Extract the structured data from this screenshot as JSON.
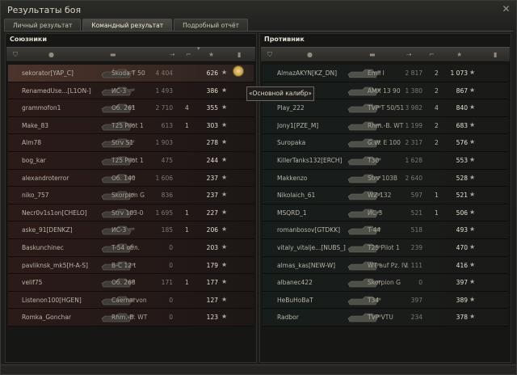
{
  "window": {
    "title": "Результаты боя",
    "close_glyph": "✕"
  },
  "tabs": [
    {
      "label": "Личный результат",
      "active": false
    },
    {
      "label": "Командный результат",
      "active": true
    },
    {
      "label": "Подробный отчёт",
      "active": false
    }
  ],
  "tooltip": "«Основной калибр»",
  "allies": {
    "title": "Союзники",
    "rows": [
      {
        "player": "sekorator[YAP_C]",
        "tank": "Škoda T 50",
        "damage": "4 404",
        "kills": "",
        "xp": "626",
        "self": true
      },
      {
        "player": "RenamedUse...[L1ON-]",
        "tank": "ИС-3",
        "damage": "1 493",
        "kills": "",
        "xp": "386"
      },
      {
        "player": "grammofon1",
        "tank": "Об. 261",
        "damage": "2 710",
        "kills": "4",
        "xp": "355"
      },
      {
        "player": "Make_83",
        "tank": "T25 Pilot 1",
        "damage": "613",
        "kills": "1",
        "xp": "303"
      },
      {
        "player": "Alm78",
        "tank": "Strv S1",
        "damage": "1 903",
        "kills": "",
        "xp": "278"
      },
      {
        "player": "bog_kar",
        "tank": "T25 Pilot 1",
        "damage": "475",
        "kills": "",
        "xp": "244"
      },
      {
        "player": "alexandroterror",
        "tank": "Об. 140",
        "damage": "1 606",
        "kills": "",
        "xp": "237"
      },
      {
        "player": "niko_757",
        "tank": "Skorpion G",
        "damage": "836",
        "kills": "",
        "xp": "237"
      },
      {
        "player": "Necr0v1s1on[CHELO]",
        "tank": "Strv 103-0",
        "damage": "1 695",
        "kills": "1",
        "xp": "227"
      },
      {
        "player": "aske_91[DENKZ]",
        "tank": "ИС-3",
        "damage": "185",
        "kills": "1",
        "xp": "206"
      },
      {
        "player": "Baskunchinec",
        "tank": "T-54 обл.",
        "damage": "0",
        "kills": "",
        "xp": "203"
      },
      {
        "player": "pavliknsk_mk5[H-A-S]",
        "tank": "В-С 12 t",
        "damage": "0",
        "kills": "",
        "xp": "179"
      },
      {
        "player": "velif75",
        "tank": "Об. 268",
        "damage": "171",
        "kills": "1",
        "xp": "177"
      },
      {
        "player": "Listenon100[HGEN]",
        "tank": "Caernarvon",
        "damage": "0",
        "kills": "",
        "xp": "127"
      },
      {
        "player": "Romka_Gonchar",
        "tank": "Rhm.-В. WT",
        "damage": "0",
        "kills": "",
        "xp": "123"
      }
    ]
  },
  "enemies": {
    "title": "Противник",
    "rows": [
      {
        "player": "AlmazAKYN[KZ_DN]",
        "tank": "Emil I",
        "damage": "2 817",
        "kills": "2",
        "xp": "1 073"
      },
      {
        "player": "...AIKO]",
        "tank": "AMX 13 90",
        "damage": "1 380",
        "kills": "2",
        "xp": "867"
      },
      {
        "player": "Play_222",
        "tank": "TVP T 50/51",
        "damage": "3 982",
        "kills": "4",
        "xp": "840"
      },
      {
        "player": "Jony1[PZE_M]",
        "tank": "Rhm.-В. WT",
        "damage": "1 199",
        "kills": "2",
        "xp": "683"
      },
      {
        "player": "Suropaka",
        "tank": "G.W. E 100",
        "damage": "2 317",
        "kills": "2",
        "xp": "576"
      },
      {
        "player": "KillerTanks132[ERCH]",
        "tank": "T30",
        "damage": "1 628",
        "kills": "",
        "xp": "553"
      },
      {
        "player": "Makkenzo",
        "tank": "Strv 103B",
        "damage": "2 640",
        "kills": "",
        "xp": "528"
      },
      {
        "player": "Nikolaich_61",
        "tank": "WZ-132",
        "damage": "597",
        "kills": "1",
        "xp": "521"
      },
      {
        "player": "MSQRD_1",
        "tank": "ИС-3",
        "damage": "521",
        "kills": "1",
        "xp": "506"
      },
      {
        "player": "romanbosov[GTDKK]",
        "tank": "T-44",
        "damage": "518",
        "kills": "",
        "xp": "493"
      },
      {
        "player": "vitaly_vitalje...[NUBS_]",
        "tank": "T25 Pilot 1",
        "damage": "239",
        "kills": "",
        "xp": "470"
      },
      {
        "player": "almas_kas[NEW-W]",
        "tank": "WT auf Pz. IV",
        "damage": "1 111",
        "kills": "",
        "xp": "416"
      },
      {
        "player": "albanec422",
        "tank": "Skorpion G",
        "damage": "0",
        "kills": "",
        "xp": "397"
      },
      {
        "player": "HeBuHoBaT",
        "tank": "T34",
        "damage": "397",
        "kills": "",
        "xp": "389"
      },
      {
        "player": "Radbor",
        "tank": "TVP VTU",
        "damage": "234",
        "kills": "",
        "xp": "378"
      }
    ]
  },
  "icons": {
    "star": "★",
    "sort": "▾",
    "header_icons": [
      "shield-icon",
      "player-icon",
      "vehicle-icon",
      "damage-icon",
      "kills-icon",
      "xp-star-icon",
      "status-icon"
    ]
  }
}
